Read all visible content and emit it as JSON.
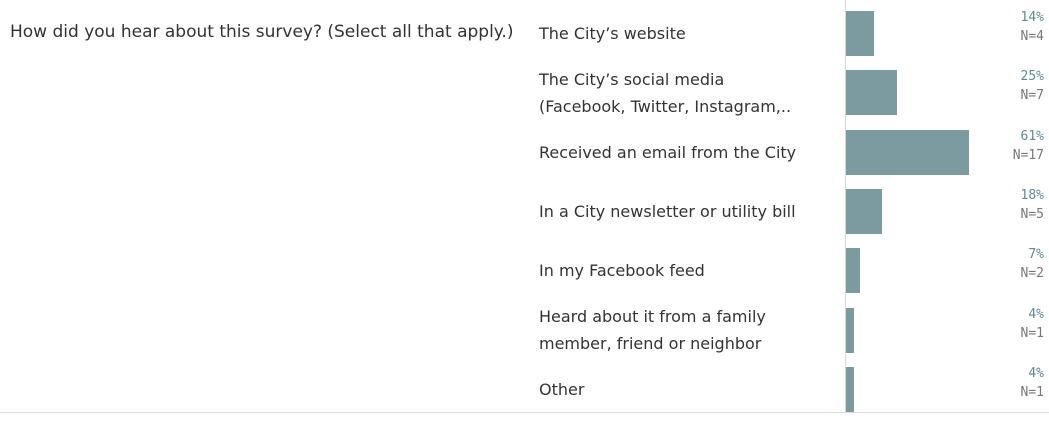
{
  "question": "How did you hear about this survey? (Select all that apply.)",
  "colors": {
    "bar": "#7b9ba1",
    "pct": "#5f8a91",
    "n": "#777777"
  },
  "chart_data": {
    "type": "bar",
    "orientation": "horizontal",
    "xlim": [
      0,
      100
    ],
    "categories": [
      [
        "The City’s website"
      ],
      [
        "The City’s social media",
        "(Facebook, Twitter, Instagram,.."
      ],
      [
        "Received an email from the City"
      ],
      [
        "In a City newsletter or utility bill"
      ],
      [
        "In my Facebook feed"
      ],
      [
        "Heard about it from a family",
        "member, friend or neighbor"
      ],
      [
        "Other"
      ]
    ],
    "values": [
      14,
      25,
      61,
      18,
      7,
      4,
      4
    ],
    "pct_labels": [
      "14%",
      "25%",
      "61%",
      "18%",
      "7%",
      "4%",
      "4%"
    ],
    "n_labels": [
      "N=4",
      "N=7",
      "N=17",
      "N=5",
      "N=2",
      "N=1",
      "N=1"
    ]
  }
}
